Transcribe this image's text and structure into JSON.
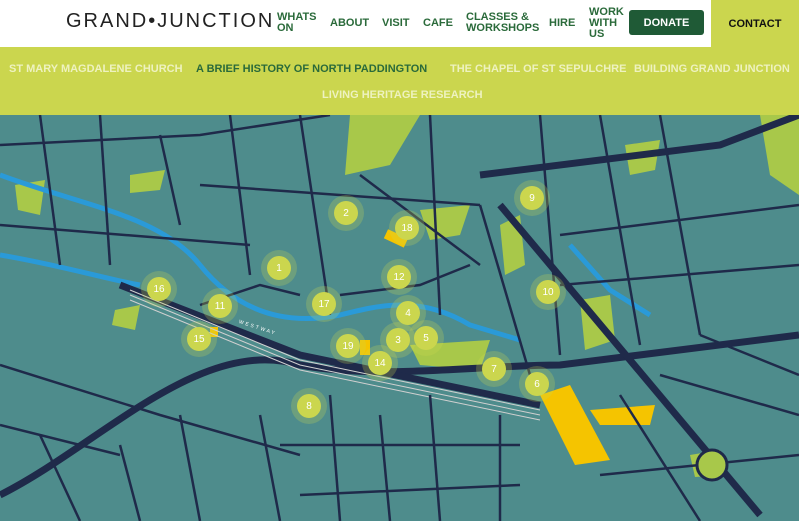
{
  "header": {
    "logo": "GRAND•JUNCTION",
    "nav": [
      "WHATS ON",
      "ABOUT",
      "VISIT",
      "CAFE",
      "CLASSES & WORKSHOPS",
      "HIRE",
      "WORK WITH US"
    ],
    "donate": "DONATE",
    "contact": "CONTACT"
  },
  "subnav": {
    "items": [
      "ST MARY MAGDALENE CHURCH",
      "A BRIEF HISTORY OF NORTH PADDINGTON",
      "THE CHAPEL OF ST SEPULCHRE",
      "BUILDING GRAND JUNCTION",
      "LIVING HERITAGE RESEARCH"
    ],
    "active": "A BRIEF HISTORY OF NORTH PADDINGTON"
  },
  "map": {
    "colors": {
      "land": "#4e8c8c",
      "road": "#1f2a4a",
      "park": "#a8c84a",
      "canal": "#2a9ad8",
      "marker": "#cbd64e",
      "building": "#f5c400"
    },
    "road_label": "WESTWAY",
    "markers": [
      "1",
      "2",
      "3",
      "4",
      "5",
      "6",
      "7",
      "8",
      "9",
      "10",
      "11",
      "12",
      "14",
      "15",
      "16",
      "17",
      "18",
      "19"
    ]
  }
}
